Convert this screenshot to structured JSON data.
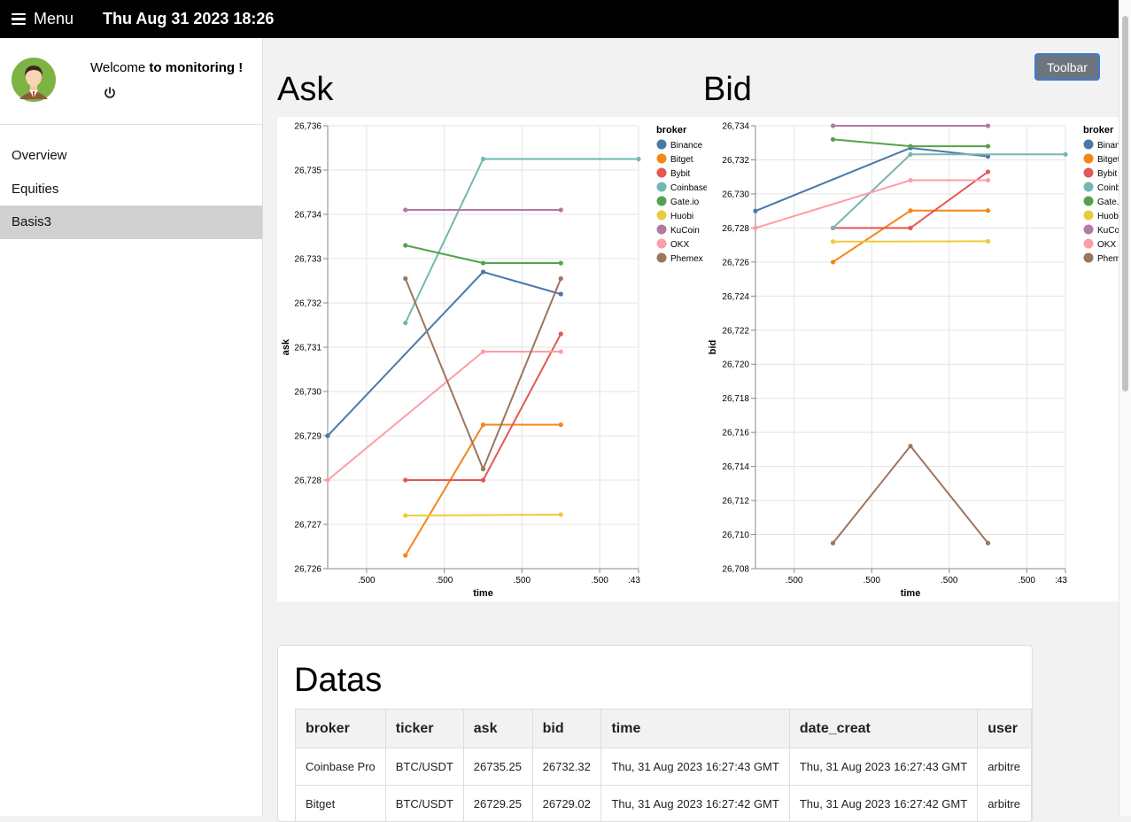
{
  "topbar": {
    "menu_label": "Menu",
    "datetime": "Thu Aug 31 2023 18:26"
  },
  "sidebar": {
    "welcome_prefix": "Welcome ",
    "welcome_bold": "to monitoring !",
    "items": [
      {
        "label": "Overview",
        "active": false
      },
      {
        "label": "Equities",
        "active": false
      },
      {
        "label": "Basis3",
        "active": true
      }
    ]
  },
  "toolbar": {
    "label": "Toolbar"
  },
  "charts": {
    "ask_title": "Ask",
    "bid_title": "Bid"
  },
  "chart_data": [
    {
      "type": "line",
      "title": "Ask",
      "xlabel": "time",
      "ylabel": "ask",
      "ylim": [
        26726,
        26736
      ],
      "y_ticks": [
        "26,726",
        "26,727",
        "26,728",
        "26,729",
        "26,730",
        "26,731",
        "26,732",
        "26,733",
        "26,734",
        "26,735",
        "26,736"
      ],
      "x_ticks": [
        ".500",
        ".500",
        ".500",
        ".500",
        ":43"
      ],
      "x_tick_pos": [
        0.5,
        1.5,
        2.5,
        3.5,
        4.0
      ],
      "xlim": [
        0,
        4
      ],
      "grid": true,
      "legend_title": "broker",
      "legend_position": "right",
      "series": [
        {
          "name": "Binance",
          "color": "#4c78a8",
          "x": [
            0,
            2,
            3
          ],
          "y": [
            26729.0,
            26732.7,
            26732.2
          ]
        },
        {
          "name": "Bitget",
          "color": "#f58518",
          "x": [
            1,
            2,
            3
          ],
          "y": [
            26726.3,
            26729.25,
            26729.25
          ]
        },
        {
          "name": "Bybit",
          "color": "#e45756",
          "x": [
            1,
            2,
            3
          ],
          "y": [
            26728.0,
            26728.0,
            26731.3
          ]
        },
        {
          "name": "Coinbase Pro",
          "color": "#72b7b2",
          "x": [
            1,
            2,
            4
          ],
          "y": [
            26731.55,
            26735.25,
            26735.25
          ]
        },
        {
          "name": "Gate.io",
          "color": "#54a24b",
          "x": [
            1,
            2,
            3
          ],
          "y": [
            26733.3,
            26732.9,
            26732.9
          ]
        },
        {
          "name": "Huobi",
          "color": "#eeca3b",
          "x": [
            1,
            3
          ],
          "y": [
            26727.2,
            26727.22
          ]
        },
        {
          "name": "KuCoin",
          "color": "#b279a2",
          "x": [
            1,
            3
          ],
          "y": [
            26734.1,
            26734.1
          ]
        },
        {
          "name": "OKX",
          "color": "#ff9da6",
          "x": [
            0,
            2,
            3
          ],
          "y": [
            26728.0,
            26730.9,
            26730.9
          ]
        },
        {
          "name": "Phemex",
          "color": "#9d755d",
          "x": [
            1,
            2,
            3
          ],
          "y": [
            26732.55,
            26728.25,
            26732.55
          ]
        }
      ]
    },
    {
      "type": "line",
      "title": "Bid",
      "xlabel": "time",
      "ylabel": "bid",
      "ylim": [
        26708,
        26734
      ],
      "y_ticks": [
        "26,708",
        "26,710",
        "26,712",
        "26,714",
        "26,716",
        "26,718",
        "26,720",
        "26,722",
        "26,724",
        "26,726",
        "26,728",
        "26,730",
        "26,732",
        "26,734"
      ],
      "x_ticks": [
        ".500",
        ".500",
        ".500",
        ".500",
        ":43"
      ],
      "x_tick_pos": [
        0.5,
        1.5,
        2.5,
        3.5,
        4.0
      ],
      "xlim": [
        0,
        4
      ],
      "grid": true,
      "legend_title": "broker",
      "legend_position": "right",
      "series": [
        {
          "name": "Binance",
          "color": "#4c78a8",
          "x": [
            0,
            2,
            3
          ],
          "y": [
            26729.0,
            26732.7,
            26732.2
          ]
        },
        {
          "name": "Bitget",
          "color": "#f58518",
          "x": [
            1,
            2,
            3
          ],
          "y": [
            26726.0,
            26729.02,
            26729.02
          ]
        },
        {
          "name": "Bybit",
          "color": "#e45756",
          "x": [
            1,
            2,
            3
          ],
          "y": [
            26728.0,
            26728.0,
            26731.3
          ]
        },
        {
          "name": "Coinbase Pro",
          "color": "#72b7b2",
          "x": [
            1,
            2,
            4
          ],
          "y": [
            26728.0,
            26732.32,
            26732.32
          ]
        },
        {
          "name": "Gate.io",
          "color": "#54a24b",
          "x": [
            1,
            2,
            3
          ],
          "y": [
            26733.2,
            26732.8,
            26732.8
          ]
        },
        {
          "name": "Huobi",
          "color": "#eeca3b",
          "x": [
            1,
            3
          ],
          "y": [
            26727.2,
            26727.22
          ]
        },
        {
          "name": "KuCoin",
          "color": "#b279a2",
          "x": [
            1,
            3
          ],
          "y": [
            26734.0,
            26734.0
          ]
        },
        {
          "name": "OKX",
          "color": "#ff9da6",
          "x": [
            0,
            2,
            3
          ],
          "y": [
            26728.0,
            26730.8,
            26730.8
          ]
        },
        {
          "name": "Phemex",
          "color": "#9d755d",
          "x": [
            1,
            2,
            3
          ],
          "y": [
            26709.5,
            26715.2,
            26709.5
          ]
        }
      ]
    }
  ],
  "datas": {
    "title": "Datas",
    "columns": [
      "broker",
      "ticker",
      "ask",
      "bid",
      "time",
      "date_creat",
      "user"
    ],
    "rows": [
      [
        "Coinbase Pro",
        "BTC/USDT",
        "26735.25",
        "26732.32",
        "Thu, 31 Aug 2023 16:27:43 GMT",
        "Thu, 31 Aug 2023 16:27:43 GMT",
        "arbitre"
      ],
      [
        "Bitget",
        "BTC/USDT",
        "26729.25",
        "26729.02",
        "Thu, 31 Aug 2023 16:27:42 GMT",
        "Thu, 31 Aug 2023 16:27:42 GMT",
        "arbitre"
      ]
    ]
  }
}
